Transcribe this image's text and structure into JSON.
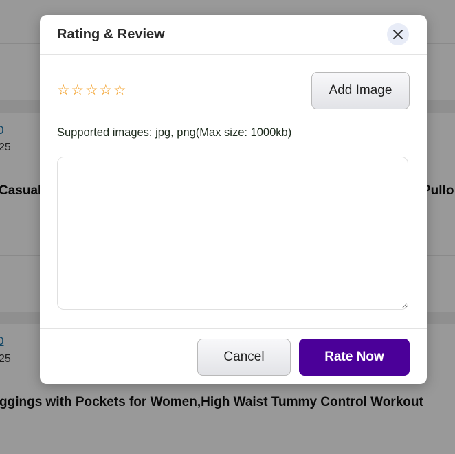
{
  "background": {
    "row1": {
      "link": "0",
      "date": "25",
      "title_left": "Casual",
      "title_right": "Pullo"
    },
    "row2": {
      "link": "0",
      "date": "25",
      "title": "ggings with Pockets for Women,High Waist Tummy Control Workout"
    }
  },
  "modal": {
    "title": "Rating & Review",
    "close_icon": "close-icon",
    "rating": {
      "max": 5,
      "value": 0,
      "star_glyph": "☆",
      "star_color": "#f29a1b"
    },
    "add_image_label": "Add Image",
    "supported_text": "Supported images: jpg, png(Max size: 1000kb)",
    "review_value": "",
    "cancel_label": "Cancel",
    "rate_label": "Rate Now",
    "accent_color": "#4b0099"
  }
}
